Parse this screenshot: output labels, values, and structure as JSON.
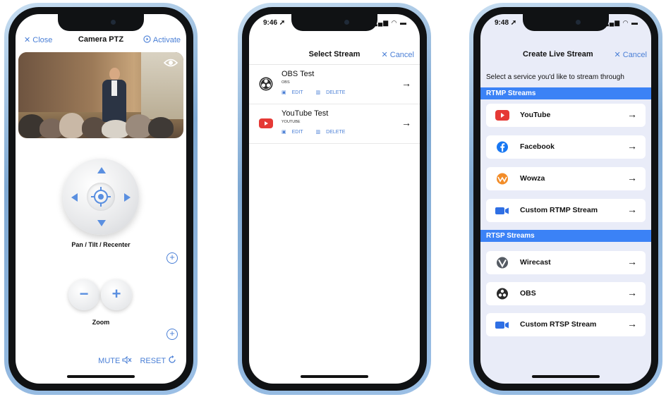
{
  "phone1": {
    "header": {
      "close": "Close",
      "title": "Camera PTZ",
      "activate": "Activate"
    },
    "pad_label": "Pan / Tilt / Recenter",
    "zoom_label": "Zoom",
    "zoom_minus": "−",
    "zoom_plus": "+",
    "plus": "+",
    "mute": "MUTE",
    "reset": "RESET"
  },
  "phone2": {
    "time": "9:46",
    "title": "Select Stream",
    "cancel": "Cancel",
    "streams": [
      {
        "name": "OBS Test",
        "service": "OBS",
        "edit": "EDIT",
        "delete": "DELETE",
        "icon": "obs-icon"
      },
      {
        "name": "YouTube Test",
        "service": "YOUTUBE",
        "edit": "EDIT",
        "delete": "DELETE",
        "icon": "youtube-icon"
      }
    ]
  },
  "phone3": {
    "time": "9:48",
    "title": "Create Live Stream",
    "cancel": "Cancel",
    "subtitle": "Select a service you'd like to stream through",
    "rtmp_header": "RTMP Streams",
    "rtsp_header": "RTSP Streams",
    "rtmp": [
      {
        "name": "YouTube",
        "icon": "youtube-icon"
      },
      {
        "name": "Facebook",
        "icon": "facebook-icon"
      },
      {
        "name": "Wowza",
        "icon": "wowza-icon"
      },
      {
        "name": "Custom RTMP Stream",
        "icon": "camera-icon"
      }
    ],
    "rtsp": [
      {
        "name": "Wirecast",
        "icon": "wirecast-icon"
      },
      {
        "name": "OBS",
        "icon": "obs-icon"
      },
      {
        "name": "Custom RTSP Stream",
        "icon": "camera-icon"
      }
    ]
  },
  "colors": {
    "accent": "#4a7fd6",
    "section_bar": "#3b82f6",
    "youtube": "#e53935",
    "facebook": "#1877f2",
    "wowza": "#f28c28"
  }
}
